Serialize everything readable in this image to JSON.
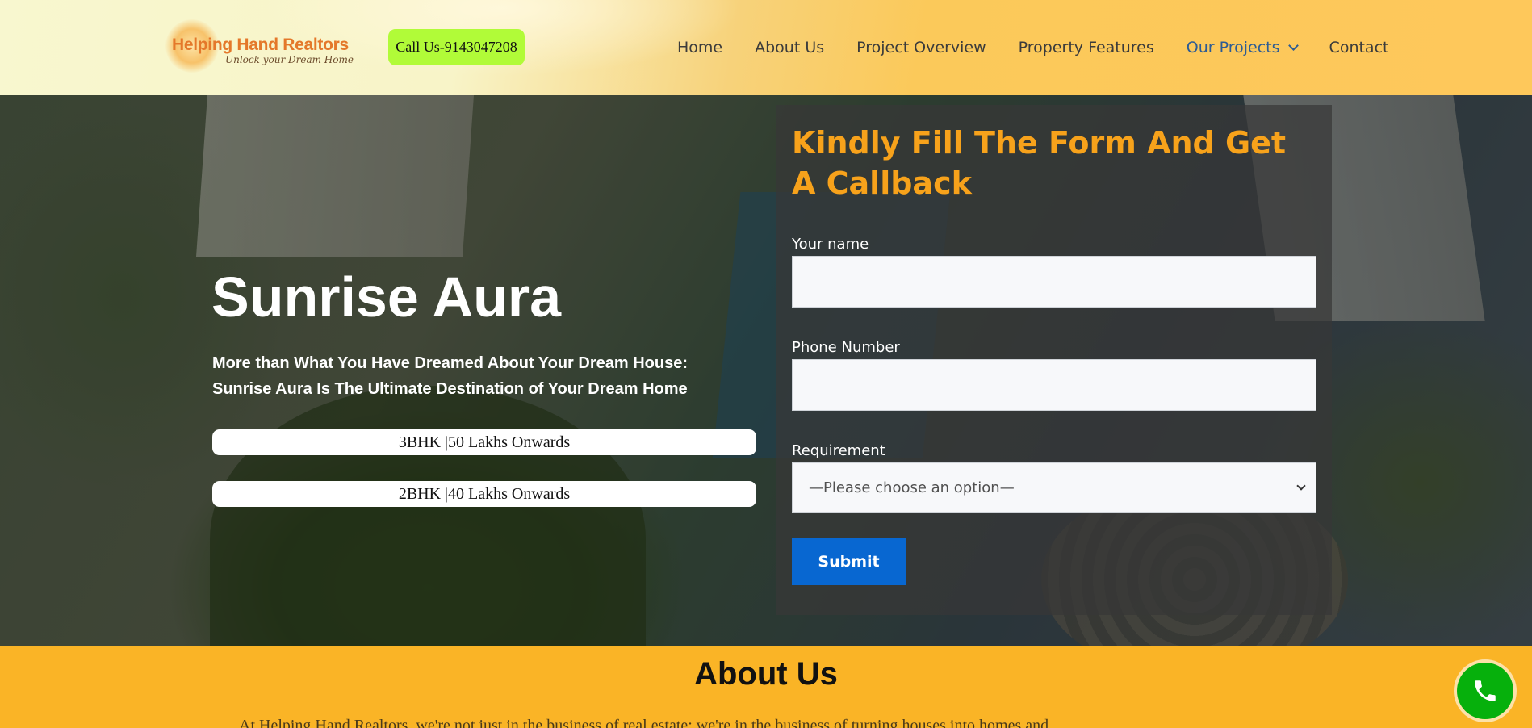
{
  "header": {
    "logo": {
      "title": "Helping Hand Realtors",
      "tagline": "Unlock your Dream Home"
    },
    "call_button": "Call Us-9143047208",
    "nav": [
      {
        "label": "Home"
      },
      {
        "label": "About Us"
      },
      {
        "label": "Project Overview"
      },
      {
        "label": "Property Features"
      },
      {
        "label": "Our Projects"
      },
      {
        "label": "Contact"
      }
    ]
  },
  "hero": {
    "title": "Sunrise Aura",
    "subtitle": "More than What You Have Dreamed About Your Dream House: Sunrise Aura Is The Ultimate Destination of Your Dream Home",
    "offers": [
      "3BHK |50 Lakhs Onwards",
      "2BHK |40 Lakhs Onwards"
    ]
  },
  "form": {
    "title": "Kindly Fill The Form And Get A Callback",
    "name_label": "Your name",
    "phone_label": "Phone Number",
    "requirement_label": "Requirement",
    "requirement_selected": "—Please choose an option—",
    "submit_label": "Submit"
  },
  "about": {
    "title": "About Us",
    "text": "At Helping Hand Realtors, we're not just in the business of real estate; we're in the business of turning houses into homes and"
  },
  "colors": {
    "form_title": "#f7a21b",
    "submit": "#0867d1",
    "call_button": "#b1fb38",
    "about_bg": "#fab426",
    "phone_fab": "#06b00c",
    "nav_active": "#2c5b94"
  }
}
